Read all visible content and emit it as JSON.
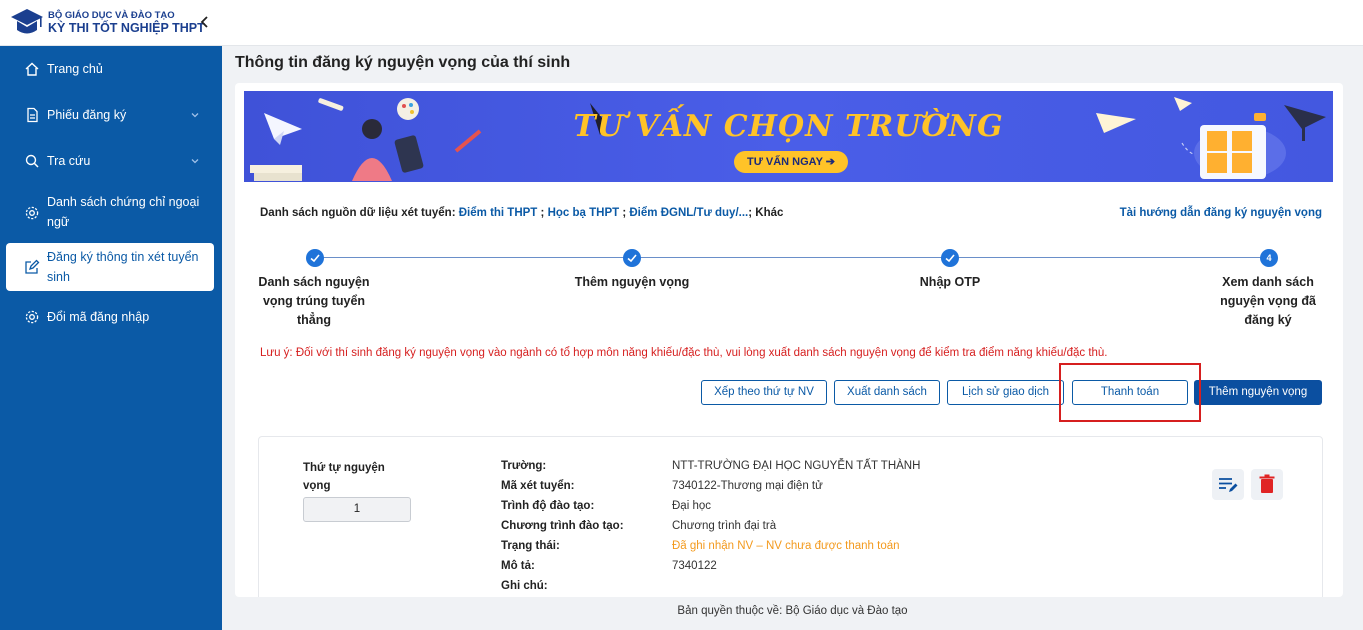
{
  "header": {
    "ministry": "BỘ GIÁO DỤC VÀ ĐÀO TẠO",
    "system": "KỲ THI TỐT NGHIỆP THPT"
  },
  "sidebar": {
    "items": [
      {
        "label": "Trang chủ",
        "icon": "home-icon"
      },
      {
        "label": "Phiếu đăng ký",
        "icon": "document-icon"
      },
      {
        "label": "Tra cứu",
        "icon": "search-icon"
      },
      {
        "label": "Danh sách chứng chỉ ngoại ngữ",
        "icon": "gear-icon"
      },
      {
        "label": "Đăng ký thông tin xét tuyển sinh",
        "icon": "edit-icon"
      },
      {
        "label": "Đổi mã đăng nhập",
        "icon": "gear-icon"
      }
    ]
  },
  "main": {
    "title": "Thông tin đăng ký nguyện vọng của thí sinh",
    "banner": {
      "title": "TƯ VẤN CHỌN TRƯỜNG",
      "button": "TƯ VẤN NGAY ➔"
    },
    "sources": {
      "prefix": "Danh sách nguồn dữ liệu xét tuyển:",
      "links": [
        "Điểm thi THPT",
        "Học bạ THPT",
        "Điểm ĐGNL/Tư duy/..."
      ],
      "suffix": "Khác"
    },
    "guide_link": "Tài hướng dẫn đăng ký nguyện vọng",
    "steps": [
      {
        "label": "Danh sách nguyện vọng trúng tuyển thẳng",
        "status": "done"
      },
      {
        "label": "Thêm nguyện vọng",
        "status": "done"
      },
      {
        "label": "Nhập OTP",
        "status": "done"
      },
      {
        "label": "Xem danh sách nguyện vọng đã đăng ký",
        "status": "current",
        "number": "4"
      }
    ],
    "note": "Lưu ý: Đối với thí sinh đăng ký nguyện vọng vào ngành có tổ hợp môn năng khiếu/đặc thù, vui lòng xuất danh sách nguyện vọng để kiểm tra điểm năng khiếu/đặc thù.",
    "actions": {
      "sort": "Xếp theo thứ tự NV",
      "export": "Xuất danh sách",
      "history": "Lịch sử giao dịch",
      "pay": "Thanh toán",
      "add": "Thêm nguyện vọng"
    },
    "wish": {
      "order_label": "Thứ tự nguyện vọng",
      "order_value": "1",
      "fields": [
        {
          "label": "Trường:",
          "value": "NTT-TRƯỜNG ĐẠI HỌC NGUYỄN TẤT THÀNH"
        },
        {
          "label": "Mã xét tuyển:",
          "value": "7340122-Thương mại điện tử"
        },
        {
          "label": "Trình độ đào tạo:",
          "value": "Đại học"
        },
        {
          "label": "Chương trình đào tạo:",
          "value": "Chương trình đại trà"
        },
        {
          "label": "Trạng thái:",
          "value": "Đã ghi nhận NV – NV chưa được thanh toán"
        },
        {
          "label": "Mô tả:",
          "value": "7340122"
        },
        {
          "label": "Ghi chú:",
          "value": ""
        }
      ]
    }
  },
  "footer": "Bản quyền thuộc về: Bộ Giáo dục và Đào tạo",
  "colors": {
    "sidebar": "#0b5aa6",
    "primary": "#0b4fa0",
    "step": "#1f73d9",
    "warning": "#d61f1f",
    "status_orange": "#f39a1e",
    "banner_accent": "#ffc328"
  }
}
